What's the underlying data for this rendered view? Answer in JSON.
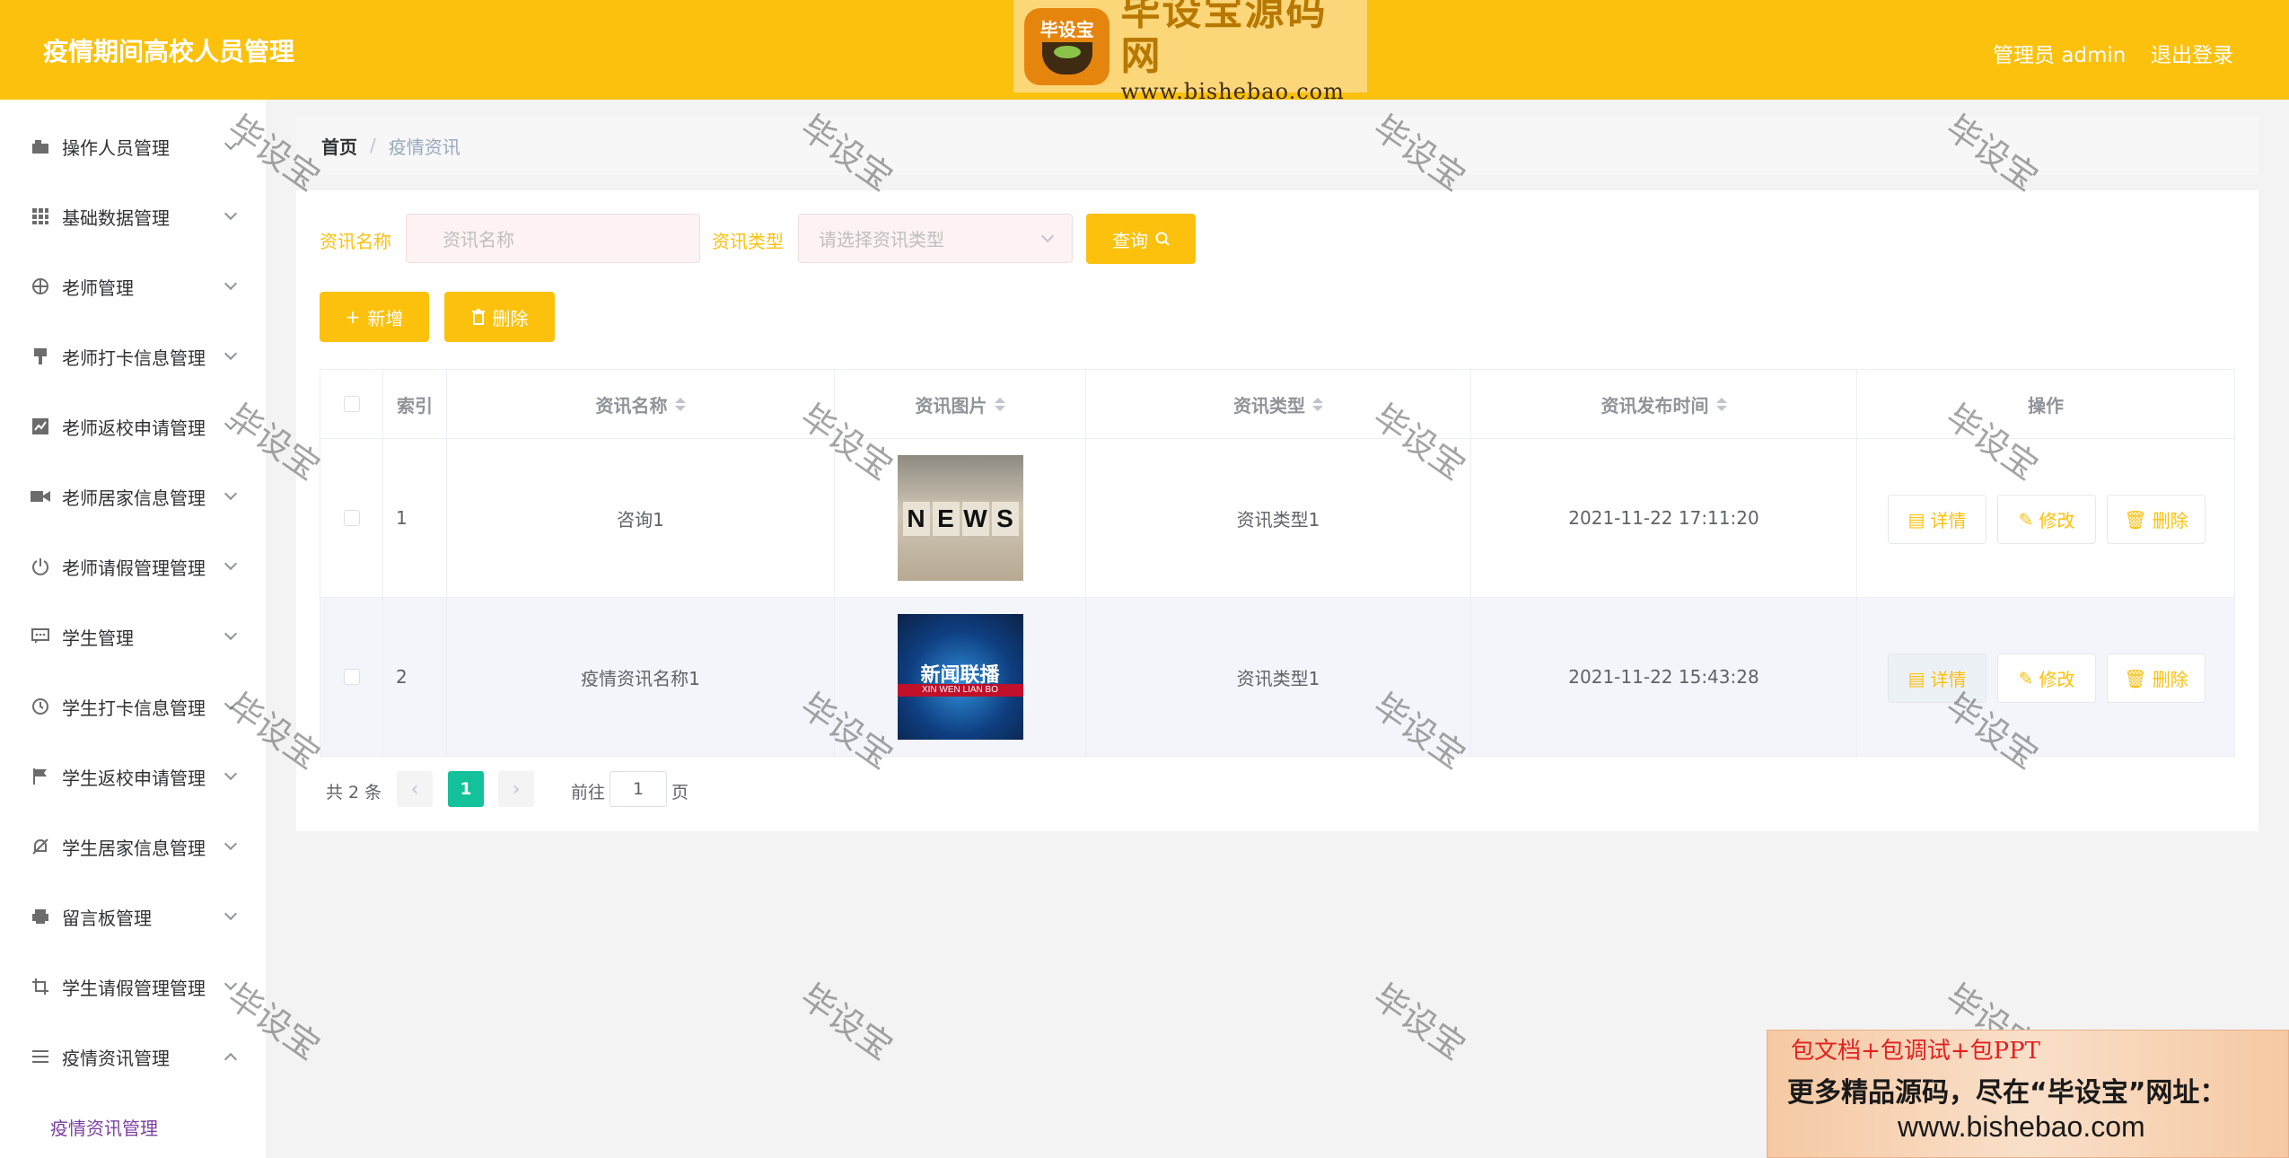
{
  "header": {
    "app_title": "疫情期间高校人员管理",
    "logo_badge": "毕设宝",
    "logo_main": "毕设宝源码网",
    "logo_url": "www.bishebao.com",
    "admin_label": "管理员 admin",
    "logout": "退出登录",
    "accent_color": "#fbc10d"
  },
  "sidebar": {
    "items": [
      {
        "label": "操作人员管理",
        "icon": "user-card-icon"
      },
      {
        "label": "基础数据管理",
        "icon": "grid-icon"
      },
      {
        "label": "老师管理",
        "icon": "compass-icon"
      },
      {
        "label": "老师打卡信息管理",
        "icon": "stamp-icon"
      },
      {
        "label": "老师返校申请管理",
        "icon": "chart-icon"
      },
      {
        "label": "老师居家信息管理",
        "icon": "camera-icon"
      },
      {
        "label": "老师请假管理管理",
        "icon": "power-icon"
      },
      {
        "label": "学生管理",
        "icon": "chat-icon"
      },
      {
        "label": "学生打卡信息管理",
        "icon": "clock-icon"
      },
      {
        "label": "学生返校申请管理",
        "icon": "flag-icon"
      },
      {
        "label": "学生居家信息管理",
        "icon": "bell-off-icon"
      },
      {
        "label": "留言板管理",
        "icon": "printer-icon"
      },
      {
        "label": "学生请假管理管理",
        "icon": "crop-icon"
      },
      {
        "label": "疫情资讯管理",
        "icon": "list-icon"
      }
    ],
    "submenu_active": "疫情资讯管理"
  },
  "breadcrumb": {
    "home": "首页",
    "separator": "/",
    "current": "疫情资讯"
  },
  "search": {
    "name_label": "资讯名称",
    "name_placeholder": "资讯名称",
    "type_label": "资讯类型",
    "type_placeholder": "请选择资讯类型",
    "query_button": "查询"
  },
  "actions": {
    "add_button": "新增",
    "delete_button": "删除"
  },
  "table": {
    "columns": [
      "索引",
      "资讯名称",
      "资讯图片",
      "资讯类型",
      "资讯发布时间",
      "操作"
    ],
    "rows": [
      {
        "index": "1",
        "name": "咨询1",
        "image": "news-cubes",
        "type": "资讯类型1",
        "time": "2021-11-22 17:11:20"
      },
      {
        "index": "2",
        "name": "疫情资讯名称1",
        "image": "xinwen-lianbo",
        "type": "资讯类型1",
        "time": "2021-11-22 15:43:28"
      }
    ],
    "op_labels": {
      "detail": "详情",
      "edit": "修改",
      "delete": "删除"
    },
    "image1_letters": [
      "N",
      "E",
      "W",
      "S"
    ],
    "image2_cn": "新闻联播",
    "image2_en": "XIN WEN LIAN BO"
  },
  "pagination": {
    "total": "共 2 条",
    "current_page": "1",
    "goto_label": "前往",
    "goto_value": "1",
    "page_label": "页",
    "active_color": "#13c19a"
  },
  "watermark": "毕设宝",
  "promo": {
    "line1": "包文档+包调试+包PPT",
    "line2": "更多精品源码，尽在“毕设宝”网址：",
    "line3": "www.bishebao.com"
  }
}
